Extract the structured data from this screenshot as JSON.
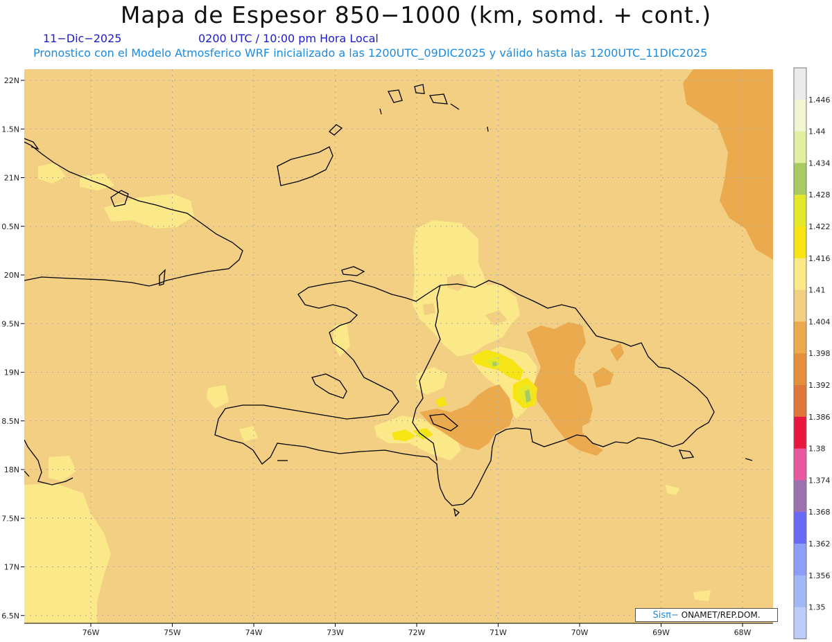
{
  "header": {
    "title": "Mapa de Espesor 850−1000 (km, somd. + cont.)",
    "date": "11−Dic−2025",
    "time": "0200 UTC / 10:00 pm Hora Local",
    "description": "Pronostico con el Modelo Atmosferico WRF inicializado a las 1200UTC_09DIC2025 y válido hasta las  1200UTC_11DIC2025"
  },
  "axes": {
    "lat_ticks": [
      "22N",
      "1.5N",
      "21N",
      "0.5N",
      "20N",
      "9.5N",
      "19N",
      "8.5N",
      "18N",
      "7.5N",
      "17N",
      "6.5N"
    ],
    "lon_ticks": [
      "76W",
      "75W",
      "74W",
      "73W",
      "72W",
      "71W",
      "70W",
      "69W",
      "68W"
    ]
  },
  "legend": {
    "labels": [
      "1.446",
      "1.44",
      "1.434",
      "1.428",
      "1.422",
      "1.416",
      "1.41",
      "1.404",
      "1.398",
      "1.392",
      "1.386",
      "1.38",
      "1.374",
      "1.368",
      "1.362",
      "1.356",
      "1.35"
    ],
    "colors": [
      "#ebebeb",
      "#f3f5d2",
      "#e0f0a0",
      "#a9c962",
      "#e3e92a",
      "#f7e414",
      "#fbe889",
      "#f2cf82",
      "#ecaa4e",
      "#e48f3c",
      "#df763a",
      "#e8163e",
      "#e7589e",
      "#9a73ae",
      "#6969f5",
      "#8d9df8",
      "#a2b8f5",
      "#bdcbf8"
    ]
  },
  "credit": {
    "brand": "Sisπ−",
    "org": " ONAMET/REP.DOM."
  },
  "colors": {
    "background_field": "#f2cf82",
    "land_outline": "#000000",
    "gridline": "#a8a8a8"
  }
}
